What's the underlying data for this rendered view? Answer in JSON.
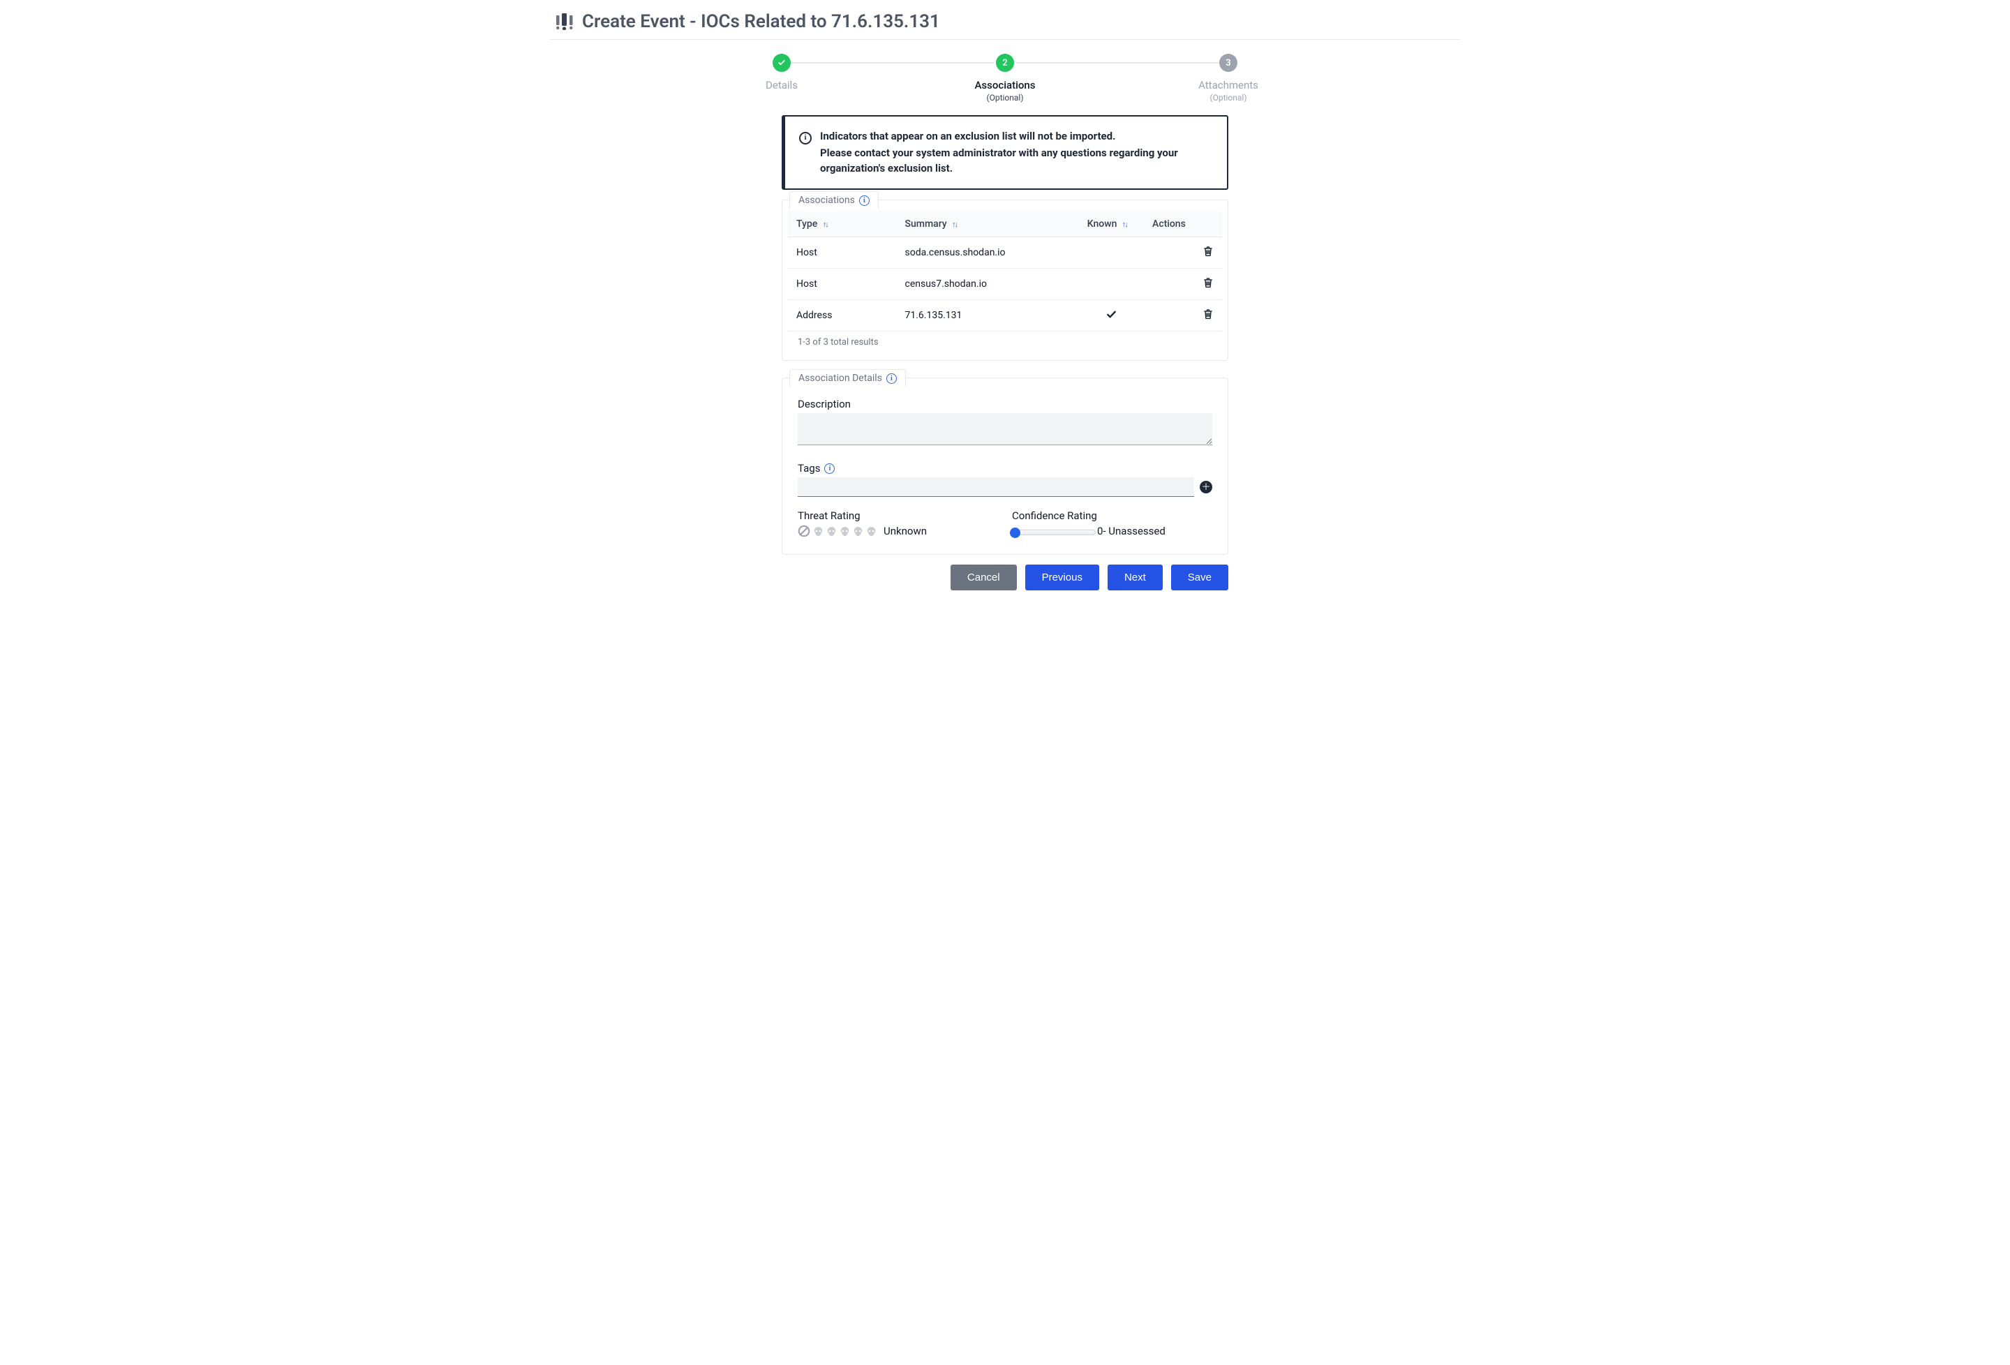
{
  "header": {
    "title": "Create Event - IOCs Related to 71.6.135.131"
  },
  "stepper": {
    "steps": [
      {
        "label": "Details",
        "sub": ""
      },
      {
        "label": "Associations",
        "sub": "(Optional)",
        "number": "2"
      },
      {
        "label": "Attachments",
        "sub": "(Optional)",
        "number": "3"
      }
    ]
  },
  "notice": {
    "line1": "Indicators that appear on an exclusion list will not be imported.",
    "line2": "Please contact your system administrator with any questions regarding your organization's exclusion list."
  },
  "associations_panel": {
    "tab_label": "Associations",
    "columns": {
      "type": "Type",
      "summary": "Summary",
      "known": "Known",
      "actions": "Actions"
    },
    "rows": [
      {
        "type": "Host",
        "summary": "soda.census.shodan.io",
        "known": false
      },
      {
        "type": "Host",
        "summary": "census7.shodan.io",
        "known": false
      },
      {
        "type": "Address",
        "summary": "71.6.135.131",
        "known": true
      }
    ],
    "result_text": "1-3 of 3 total results"
  },
  "details_panel": {
    "tab_label": "Association Details",
    "description_label": "Description",
    "description_value": "",
    "tags_label": "Tags",
    "tags_value": "",
    "threat_label": "Threat Rating",
    "threat_value_label": "Unknown",
    "confidence_label": "Confidence Rating",
    "confidence_value_label": "0- Unassessed"
  },
  "buttons": {
    "cancel": "Cancel",
    "previous": "Previous",
    "next": "Next",
    "save": "Save"
  }
}
